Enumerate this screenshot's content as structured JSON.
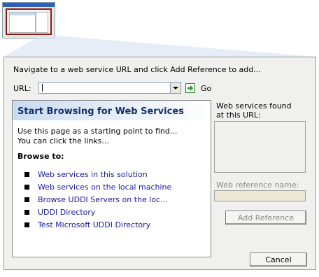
{
  "dialog": {
    "instruction": "Navigate to a web service URL and click Add Reference to add...",
    "url_label": "URL:",
    "url_value": "",
    "go_label": "Go",
    "panel": {
      "title": "Start Browsing for Web Services",
      "desc_line1": "Use this page as a starting point to find...",
      "desc_line2": "You can click the links...",
      "browse_label": "Browse to:",
      "links": [
        "Web services in this solution",
        "Web services on the local machine",
        "Browse UDDI Servers on the loc...",
        "UDDI Directory",
        "Test Microsoft UDDI Directory"
      ]
    },
    "found_label_line1": "Web services found",
    "found_label_line2": "at this URL:",
    "ref_name_label": "Web reference name:",
    "add_reference_label": "Add Reference",
    "cancel_label": "Cancel"
  },
  "colors": {
    "link": "#1a1a9a",
    "title": "#16306e",
    "callout_frame": "#8b1a1a",
    "go_arrow": "#2e9e2e"
  }
}
